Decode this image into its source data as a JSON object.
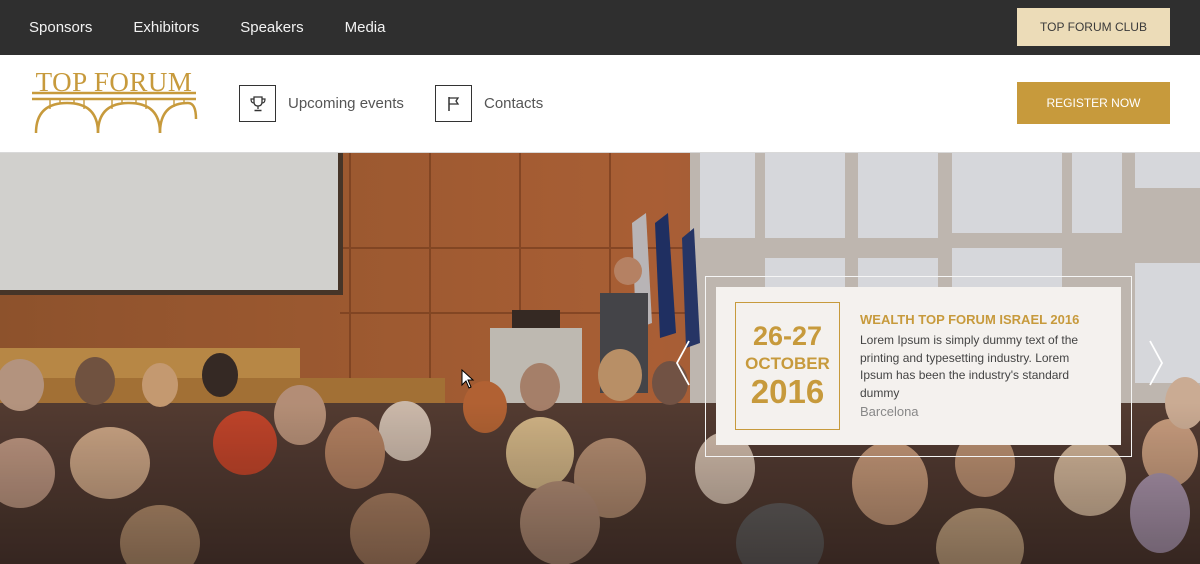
{
  "top_nav": {
    "items": [
      "Sponsors",
      "Exhibitors",
      "Speakers",
      "Media"
    ],
    "club_button": "TOP FORUM CLUB"
  },
  "header": {
    "logo_text": "TOP FORUM",
    "nav": [
      {
        "label": "Upcoming events",
        "icon": "trophy-icon"
      },
      {
        "label": "Contacts",
        "icon": "flag-icon"
      }
    ],
    "register_button": "REGISTER NOW"
  },
  "hero": {
    "event": {
      "days": "26-27",
      "month": "OCTOBER",
      "year": "2016",
      "title": "WEALTH TOP FORUM ISRAEL 2016",
      "description": "Lorem Ipsum is simply dummy text of the printing and typesetting industry. Lorem Ipsum has been the industry's standard dummy",
      "location": "Barcelona"
    },
    "prev_icon": "chevron-left-icon",
    "next_icon": "chevron-right-icon"
  },
  "colors": {
    "gold": "#c79a3c",
    "light_gold": "#ecdcb8",
    "dark": "#2f2f2f"
  }
}
